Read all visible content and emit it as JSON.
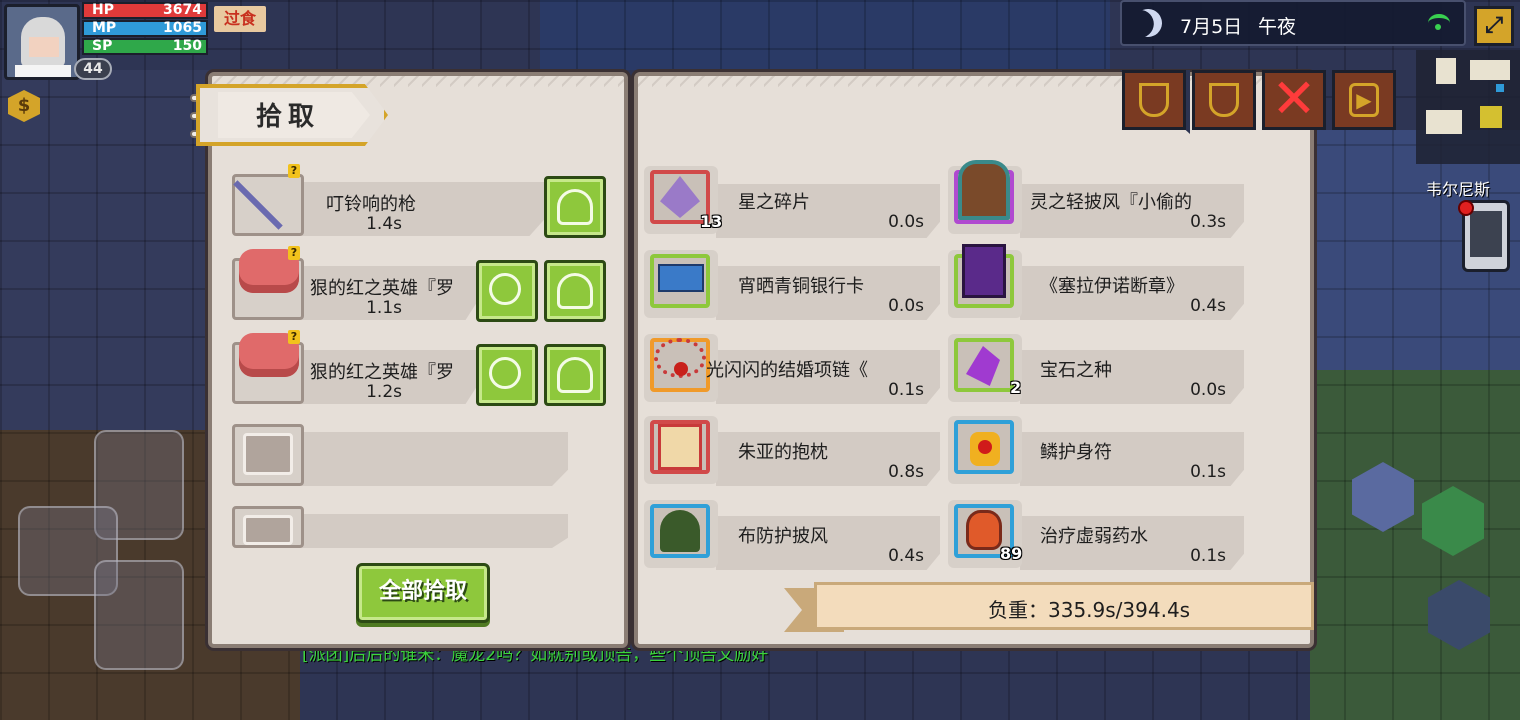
{
  "hud": {
    "hp_label": "HP",
    "hp_value": "3674",
    "mp_label": "MP",
    "mp_value": "1065",
    "sp_label": "SP",
    "sp_value": "150",
    "level": "44",
    "status_tag": "过食",
    "hp_color": "#e03a3a",
    "mp_color": "#2f9ad8",
    "sp_color": "#2fa84a"
  },
  "topbar": {
    "date": "7月5日",
    "time_of_day": "午夜",
    "location": "韦尔尼斯",
    "map_icon": "expand-icon"
  },
  "pickup_panel": {
    "title": "拾取",
    "pickup_all_label": "全部拾取",
    "items": [
      {
        "name": "叮铃响的枪",
        "weight": "1.4s",
        "icon": "spear-icon",
        "unknown": true
      },
      {
        "name": "狠的红之英雄『罗",
        "weight": "1.1s",
        "icon": "meat-icon",
        "unknown": true
      },
      {
        "name": "狠的红之英雄『罗",
        "weight": "1.2s",
        "icon": "meat-icon",
        "unknown": true
      }
    ],
    "unknown_mark": "?"
  },
  "inventory_panel": {
    "left_column": [
      {
        "name": "星之碎片",
        "weight": "0.0s",
        "count": "13",
        "frame": "#d14a4a",
        "icon": "crystal-icon"
      },
      {
        "name": "宵晒青铜银行卡",
        "weight": "0.0s",
        "count": "",
        "frame": "#8ec83c",
        "icon": "card-icon"
      },
      {
        "name": "光闪闪的结婚项链《",
        "weight": "0.1s",
        "count": "",
        "frame": "#f09a2a",
        "icon": "necklace-icon"
      },
      {
        "name": "朱亚的抱枕",
        "weight": "0.8s",
        "count": "",
        "frame": "#d14a4a",
        "icon": "pillow-icon"
      },
      {
        "name": "布防护披风",
        "weight": "0.4s",
        "count": "",
        "frame": "#2fa0d8",
        "icon": "cloak-icon"
      }
    ],
    "right_column": [
      {
        "name": "灵之轻披风『小偷的",
        "weight": "0.3s",
        "count": "",
        "frame": "#b04ad0",
        "icon": "cape-icon"
      },
      {
        "name": "《塞拉伊诺断章》",
        "weight": "0.4s",
        "count": "",
        "frame": "#8ec83c",
        "icon": "book-icon"
      },
      {
        "name": "宝石之种",
        "weight": "0.0s",
        "count": "2",
        "frame": "#8ec83c",
        "icon": "gem-seed-icon"
      },
      {
        "name": "鳞护身符",
        "weight": "0.1s",
        "count": "",
        "frame": "#2fa0d8",
        "icon": "amulet-icon"
      },
      {
        "name": "治疗虚弱药水",
        "weight": "0.1s",
        "count": "89",
        "frame": "#2fa0d8",
        "icon": "potion-icon"
      }
    ],
    "weight_text": "负重：335.9s/394.4s"
  },
  "chat": {
    "line": "[派团]后后的谁米：魔龙2吗？如就别或顶告，些个顶告文励好"
  }
}
